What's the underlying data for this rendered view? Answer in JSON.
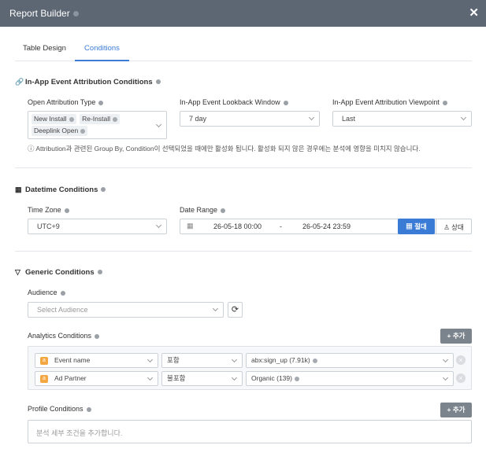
{
  "window": {
    "title": "Report Builder",
    "close_glyph": "✕"
  },
  "tabs": [
    {
      "label": "Table Design",
      "active": false
    },
    {
      "label": "Conditions",
      "active": true
    }
  ],
  "attribution": {
    "title": "In-App Event Attribution Conditions",
    "icon": "link-icon",
    "open_type": {
      "label": "Open Attribution Type",
      "tags": [
        "New Install",
        "Re-Install",
        "Deeplink Open"
      ]
    },
    "lookback": {
      "label": "In-App Event Lookback Window",
      "value": "7 day"
    },
    "viewpoint": {
      "label": "In-App Event Attribution Viewpoint",
      "value": "Last"
    },
    "hint": "ⓘ Attribution과 관련된 Group By, Condition이 선택되었을 때에만 활성화 됩니다. 활성화 되지 않은 경우에는 분석에 영향을 미치지 않습니다."
  },
  "datetime": {
    "title": "Datetime Conditions",
    "icon": "calendar-icon",
    "timezone": {
      "label": "Time Zone",
      "value": "UTC+9"
    },
    "date_range": {
      "label": "Date Range",
      "start": "26-05-18 00:00",
      "separator": "-",
      "end": "26-05-24 23:59",
      "absolute_label": "절대",
      "relative_label": "상대"
    }
  },
  "generic": {
    "title": "Generic Conditions",
    "icon": "filter-icon",
    "audience": {
      "label": "Audience",
      "placeholder": "Select Audience",
      "refresh_glyph": "⟳"
    },
    "analytics": {
      "label": "Analytics Conditions",
      "add_label": "+ 추가",
      "rows": [
        {
          "field": "Event name",
          "operator": "포함",
          "value": "abx:sign_up (7.91k)"
        },
        {
          "field": "Ad Partner",
          "operator": "불포함",
          "value": "Organic (139)"
        }
      ]
    },
    "profile": {
      "label": "Profile Conditions",
      "add_label": "+ 추가",
      "placeholder": "분석 세부 조건을 추가합니다."
    }
  },
  "colors": {
    "header": "#5d6774",
    "accent": "#3a7bd5",
    "add_button": "#7b838c",
    "condition_icon": "#f4a640"
  }
}
